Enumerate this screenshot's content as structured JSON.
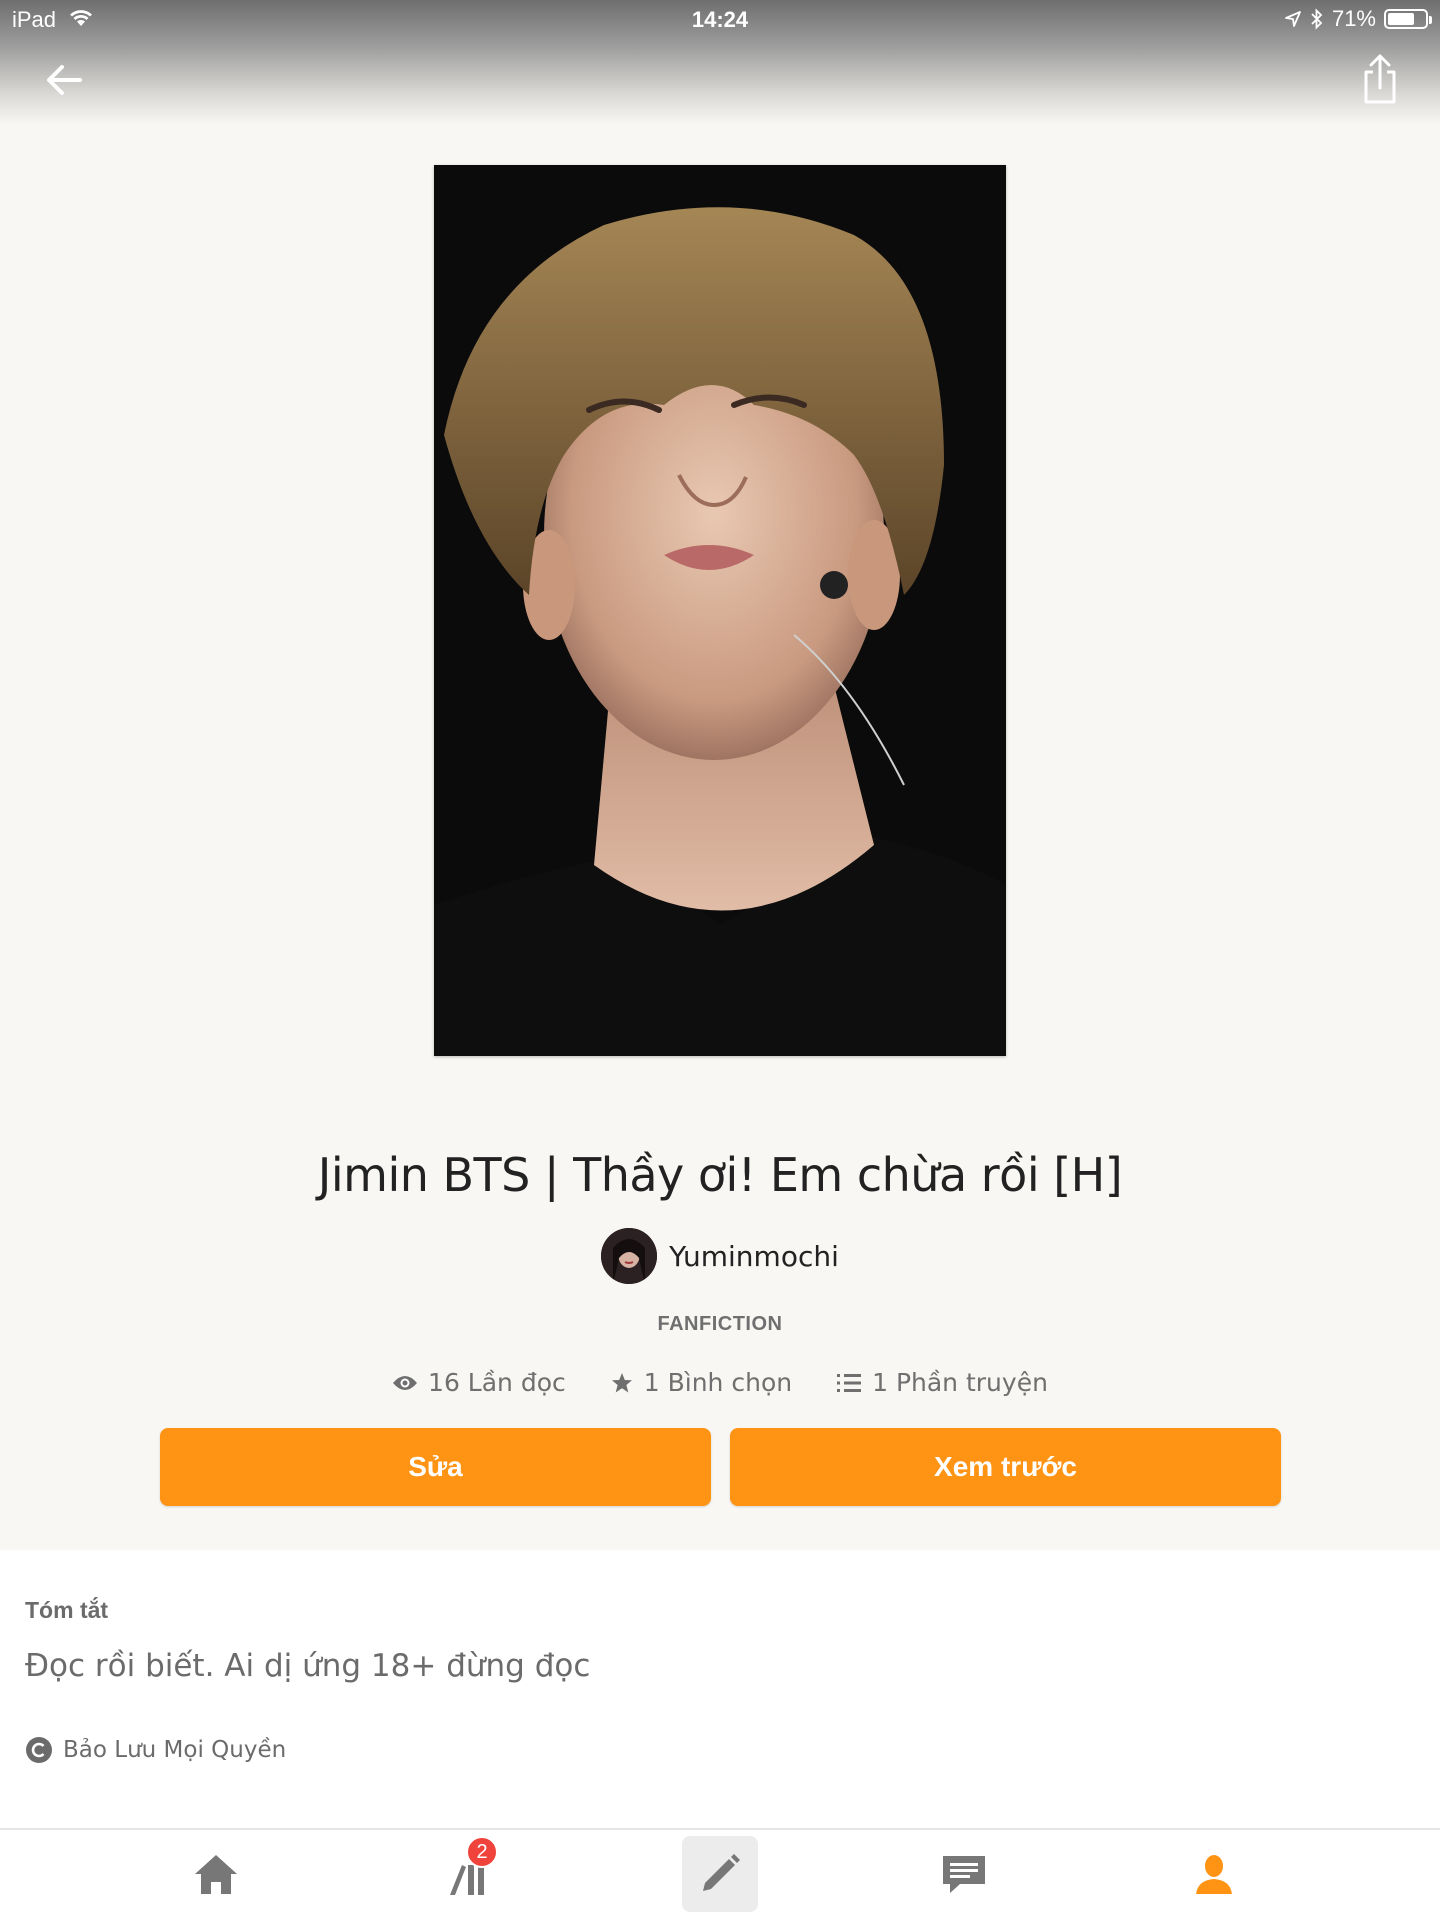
{
  "status_bar": {
    "device": "iPad",
    "time": "14:24",
    "battery": "71%",
    "battery_level": 0.71
  },
  "story": {
    "title": "Jimin BTS | Thầy ơi! Em chừa rồi [H]",
    "author": "Yuminmochi",
    "category": "FANFICTION",
    "stats": {
      "reads": "16 Lần đọc",
      "votes": "1 Bình chọn",
      "parts": "1 Phần truyện"
    }
  },
  "actions": {
    "edit_label": "Sửa",
    "preview_label": "Xem trước"
  },
  "summary": {
    "heading": "Tóm tắt",
    "text": "Đọc rồi biết. Ai dị ứng 18+ đừng đọc",
    "copyright": "Bảo Lưu Mọi Quyền"
  },
  "bottom_nav": {
    "library_badge": "2",
    "items": [
      "home-icon",
      "library-icon",
      "write-icon",
      "messages-icon",
      "profile-icon"
    ]
  },
  "colors": {
    "accent": "#ff9314",
    "background": "#f8f7f3",
    "badge": "#f0433b",
    "muted_text": "#6f6f6f"
  }
}
